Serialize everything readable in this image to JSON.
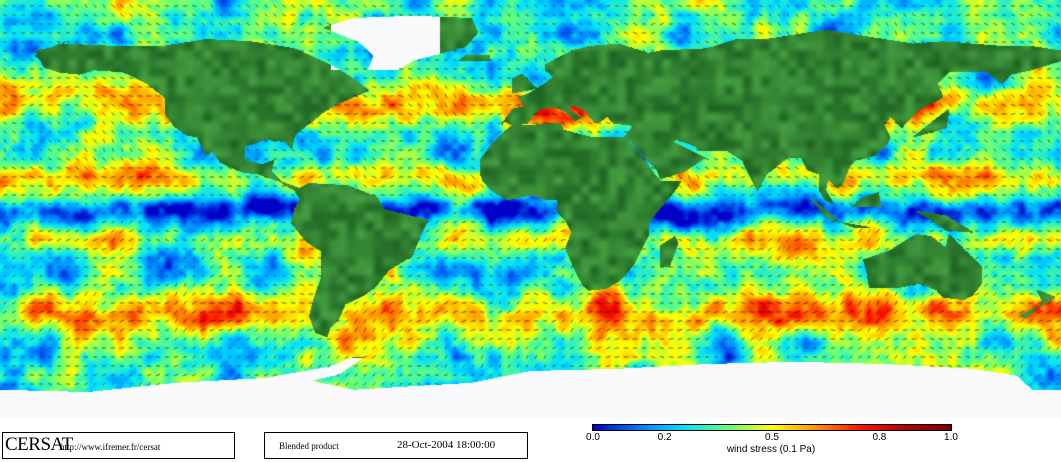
{
  "map": {
    "product": "ocean surface wind stress field with direction arrows",
    "colormap": [
      "#0000c8",
      "#0078ff",
      "#00e0ff",
      "#60ff80",
      "#ffff00",
      "#ff9000",
      "#ff1000",
      "#b40000",
      "#780000"
    ],
    "land_color": "#2e7d32",
    "ice_color": "#ffffff"
  },
  "footer": {
    "logo": "CERSAT",
    "url": "http://www.ifremer.fr/cersat",
    "product": "Blended product",
    "datetime": "28-Oct-2004 18:00:00"
  },
  "colorbar": {
    "ticks": [
      {
        "label": "0.0",
        "value": 0.0
      },
      {
        "label": "0.2",
        "value": 0.2
      },
      {
        "label": "0.5",
        "value": 0.5
      },
      {
        "label": "0.8",
        "value": 0.8
      },
      {
        "label": "1.0",
        "value": 1.0
      }
    ],
    "title": "wind stress (0.1 Pa)",
    "range": [
      0.0,
      1.0
    ]
  }
}
